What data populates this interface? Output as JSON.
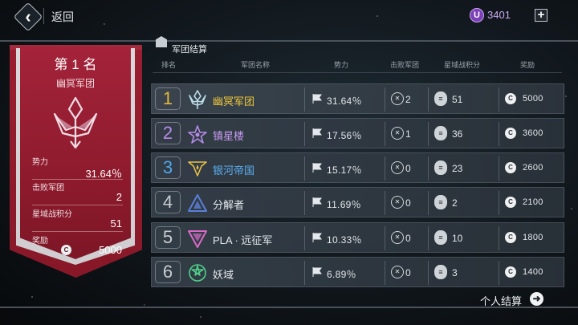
{
  "topbar": {
    "back_label": "返回",
    "currency_icon": "U",
    "currency_value": "3401",
    "add_label": "+"
  },
  "section": {
    "title": "军团结算"
  },
  "columns": {
    "rank": "排名",
    "name": "军团名称",
    "power": "势力",
    "defeats": "击败军团",
    "score": "星域战积分",
    "reward": "奖励"
  },
  "winner": {
    "rank_title": "第 1 名",
    "name": "幽冥军团",
    "power_label": "势力",
    "power_value": "31.64％",
    "defeats_label": "击败军团",
    "defeats_value": "2",
    "score_label": "星域战积分",
    "score_value": "51",
    "reward_label": "奖励",
    "reward_value": "5000"
  },
  "rows": [
    {
      "rank": "1",
      "name": "幽冥军团",
      "power": "31.64％",
      "defeats": "2",
      "score": "51",
      "reward": "5000",
      "rank_color": "#e2b93b",
      "name_color": "#f0c83a",
      "icon": "trident-emblem-icon",
      "icon_color": "#b8dbe6"
    },
    {
      "rank": "2",
      "name": "镇星楼",
      "power": "17.56％",
      "defeats": "1",
      "score": "36",
      "reward": "3600",
      "rank_color": "#b68ce8",
      "name_color": "#c79af0",
      "icon": "star-wing-emblem-icon",
      "icon_color": "#b68ce8"
    },
    {
      "rank": "3",
      "name": "银河帝国",
      "power": "15.17％",
      "defeats": "0",
      "score": "23",
      "reward": "2600",
      "rank_color": "#4fa8e8",
      "name_color": "#5aaef0",
      "icon": "wing-star-emblem-icon",
      "icon_color": "#e8c04a"
    },
    {
      "rank": "4",
      "name": "分解者",
      "power": "11.69％",
      "defeats": "0",
      "score": "2",
      "reward": "2100",
      "rank_color": "#c8ccd0",
      "name_color": "#e4e8ec",
      "icon": "triangle-emblem-icon",
      "icon_color": "#5a7fd8"
    },
    {
      "rank": "5",
      "name": "PLA · 远征军",
      "power": "10.33％",
      "defeats": "0",
      "score": "10",
      "reward": "1800",
      "rank_color": "#c8ccd0",
      "name_color": "#e4e8ec",
      "icon": "inverted-triangle-emblem-icon",
      "icon_color": "#d86ac8"
    },
    {
      "rank": "6",
      "name": "妖域",
      "power": "6.89％",
      "defeats": "0",
      "score": "3",
      "reward": "1400",
      "rank_color": "#c8ccd0",
      "name_color": "#e4e8ec",
      "icon": "tri-star-emblem-icon",
      "icon_color": "#4fd08a"
    }
  ],
  "bottom": {
    "personal_label": "个人结算"
  }
}
